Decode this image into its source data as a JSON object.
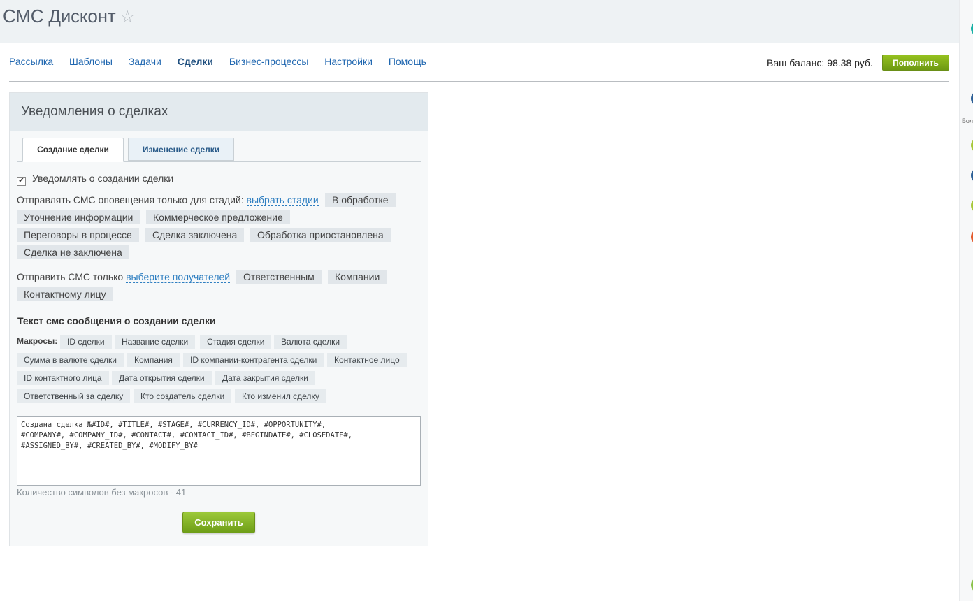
{
  "app": {
    "title": "СМС Дисконт",
    "star": "☆"
  },
  "nav": {
    "items": [
      {
        "label": "Рассылка"
      },
      {
        "label": "Шаблоны"
      },
      {
        "label": "Задачи"
      },
      {
        "label": "Сделки",
        "active": true
      },
      {
        "label": "Бизнес-процессы"
      },
      {
        "label": "Настройки"
      },
      {
        "label": "Помощь"
      }
    ]
  },
  "balance": {
    "text": "Ваш баланс: 98.38 руб.",
    "topup_label": "Пополнить"
  },
  "panel": {
    "title": "Уведомления о сделках",
    "tabs": [
      "Создание сделки",
      "Изменение сделки"
    ],
    "notify_label": "Уведомлять о создании сделки",
    "notify_checked": true,
    "stages_prefix": "Отправлять СМС оповещения только для стадий:",
    "stages_link": "выбрать стадии",
    "stages": [
      "В обработке",
      "Уточнение информации",
      "Коммерческое предложение",
      "Переговоры в процессе",
      "Сделка заключена",
      "Обработка приостановлена",
      "Сделка не заключена"
    ],
    "recipients_prefix": "Отправить СМС только",
    "recipients_link": "выберите получателей",
    "recipients": [
      "Ответственным",
      "Компании",
      "Контактному лицу"
    ],
    "text_title": "Текст смс сообщения о создании сделки",
    "macros_label": "Макросы:",
    "macros": [
      "ID сделки",
      "Название сделки",
      "Стадия сделки",
      "Валюта сделки",
      "Сумма в валюте сделки",
      "Компания",
      "ID компании-контрагента сделки",
      "Контактное лицо",
      "ID контактного лица",
      "Дата открытия сделки",
      "Дата закрытия сделки",
      "Ответственный за сделку",
      "Кто создатель сделки",
      "Кто изменил сделку"
    ],
    "message": "Создана сделка №#ID#, #TITLE#, #STAGE#, #CURRENCY_ID#, #OPPORTUNITY#,\n#COMPANY#, #COMPANY_ID#, #CONTACT#, #CONTACT_ID#, #BEGINDATE#, #CLOSEDATE#,\n#ASSIGNED_BY#, #CREATED_BY#, #MODIFY_BY#",
    "counter": "Количество символов без макросов - 41",
    "save_label": "Сохранить"
  },
  "strip": {
    "label": "Бол"
  },
  "colors": {
    "accent_green": "#7aa815",
    "link_blue": "#2f7fc1",
    "dot_teal": "#17b0a5",
    "dot_blue": "#2c5f96",
    "dot_lime": "#a7c83a",
    "dot_orange": "#e35a2c"
  }
}
